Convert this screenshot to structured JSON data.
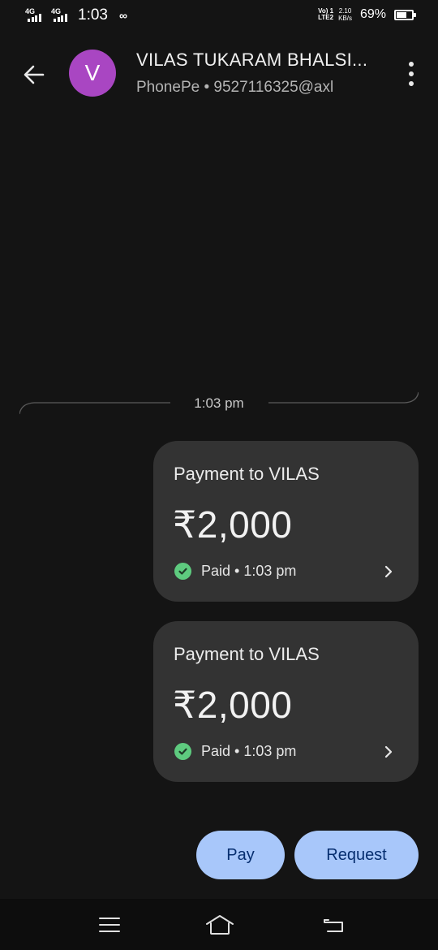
{
  "status_bar": {
    "network_1": "4G",
    "network_2": "4G",
    "time": "1:03",
    "volte_line1": "Vo) 1",
    "volte_line2": "LTE2",
    "speed_value": "2.10",
    "speed_unit": "KB/s",
    "battery_percent": "69%",
    "battery_level": 0.69
  },
  "header": {
    "avatar_letter": "V",
    "contact_name": "VILAS TUKARAM BHALSI...",
    "contact_sub": "PhonePe • 9527116325@axl",
    "icons": {
      "back": "arrow-left-icon",
      "more": "more-vert-icon"
    }
  },
  "divider": {
    "time": "1:03 pm"
  },
  "payments": [
    {
      "title": "Payment to VILAS",
      "amount": "₹2,000",
      "status": "Paid • 1:03 pm"
    },
    {
      "title": "Payment to VILAS",
      "amount": "₹2,000",
      "status": "Paid • 1:03 pm"
    }
  ],
  "actions": {
    "pay_label": "Pay",
    "request_label": "Request"
  },
  "colors": {
    "background": "#141414",
    "card": "#333333",
    "avatar": "#a946c2",
    "paid_check": "#5ecb7f",
    "button": "#a8c7fa",
    "button_text": "#062e6f"
  },
  "navigation": {
    "icons": [
      "menu-icon",
      "home-icon",
      "back-icon"
    ]
  }
}
